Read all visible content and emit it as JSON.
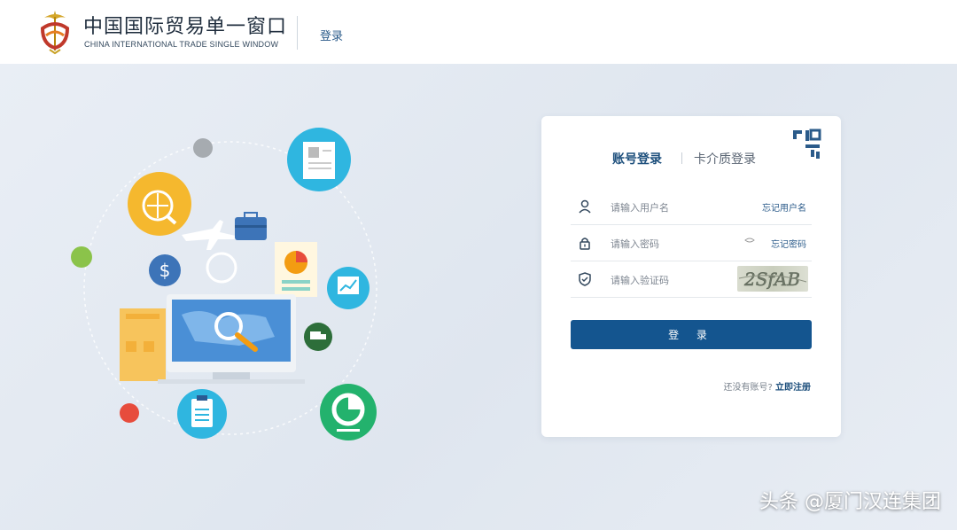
{
  "header": {
    "logo_cn": "中国国际贸易单一窗口",
    "logo_en": "CHINA INTERNATIONAL TRADE SINGLE WINDOW",
    "login_link": "登录"
  },
  "login_card": {
    "tabs": [
      {
        "label": "账号登录",
        "active": true
      },
      {
        "label": "卡介质登录",
        "active": false
      }
    ],
    "fields": {
      "username": {
        "placeholder": "请输入用户名",
        "link": "忘记用户名",
        "icon": "user-icon"
      },
      "password": {
        "placeholder": "请输入密码",
        "link": "忘记密码",
        "icon": "lock-icon"
      },
      "captcha": {
        "placeholder": "请输入验证码",
        "icon": "shield-check-icon",
        "captcha_text": "2SfAB"
      }
    },
    "login_button": "登 录",
    "register_prompt": "还没有账号?",
    "register_link": "立即注册"
  },
  "watermark": "头条 @厦门汉连集团",
  "colors": {
    "primary": "#14558f",
    "link": "#2b5b8a",
    "background": "#e6ebf2"
  }
}
